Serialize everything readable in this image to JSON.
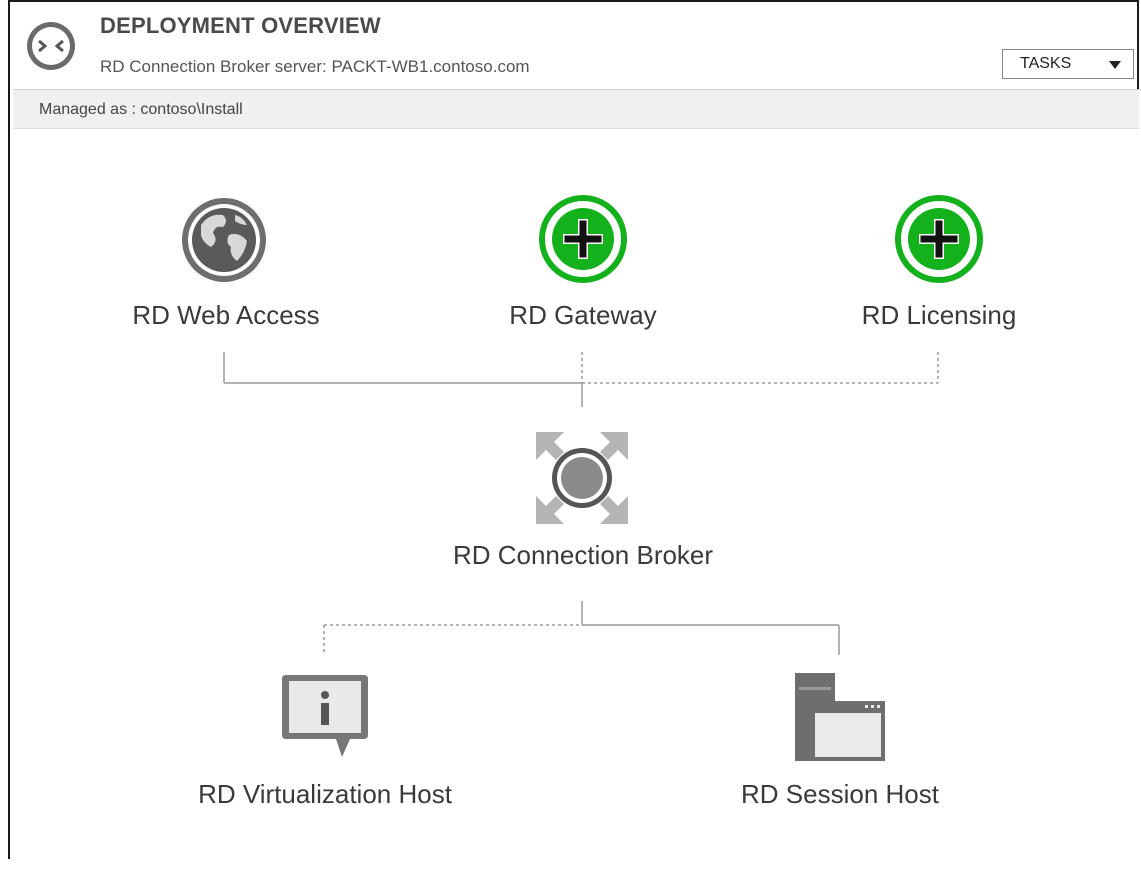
{
  "header": {
    "title": "DEPLOYMENT OVERVIEW",
    "subtitle": "RD Connection Broker server: PACKT-WB1.contoso.com",
    "tasks_label": "TASKS"
  },
  "managed_as": "Managed as : contoso\\Install",
  "nodes": {
    "web_access": "RD Web Access",
    "gateway": "RD Gateway",
    "licensing": "RD Licensing",
    "connection_broker": "RD Connection Broker",
    "virtualization_host": "RD Virtualization Host",
    "session_host": "RD Session Host"
  },
  "colors": {
    "add_green": "#13b21c",
    "icon_gray": "#6e6e6e",
    "line_gray": "#9a9a9a"
  }
}
